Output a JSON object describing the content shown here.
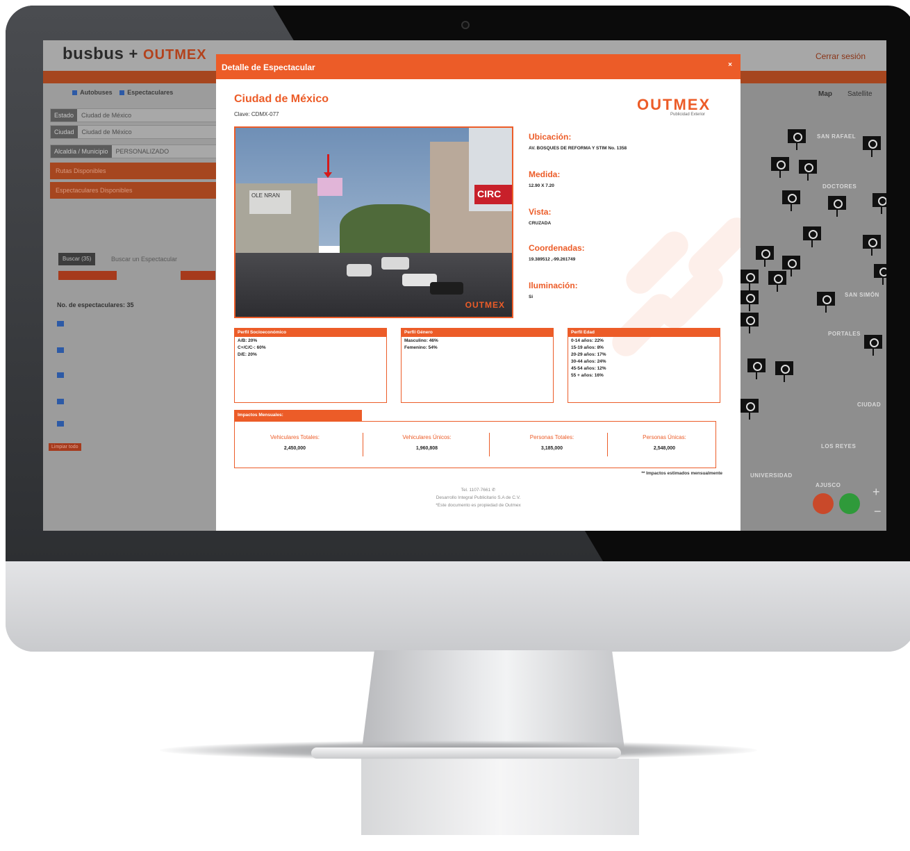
{
  "app": {
    "logo_main": "busbus",
    "logo_plus": "+",
    "logo_partner": "OUTMEX",
    "logout_label": "Cerrar sesión"
  },
  "sidebar": {
    "check_buses": "Autobuses",
    "check_billboards": "Espectaculares",
    "filters": [
      {
        "label": "Estado",
        "value": "Ciudad de México"
      },
      {
        "label": "Ciudad",
        "value": "Ciudad de México"
      },
      {
        "label": "Alcaldía / Municipio",
        "value": "PERSONALIZADO"
      }
    ],
    "sections": [
      "Rutas Disponibles",
      "Espectaculares Disponibles"
    ],
    "search_button": "Buscar (35)",
    "search_placeholder": "Buscar un Espectacular",
    "count_label": "No. de espectaculares: 35",
    "clear_label": "Limpiar todo"
  },
  "map": {
    "tab_map": "Map",
    "tab_satellite": "Satellite",
    "labels": [
      "SAN RAFAEL",
      "DOCTORES",
      "SAN SIMÓN",
      "PORTALES",
      "LOS REYES",
      "AJUSCO",
      "UNIVERSIDAD",
      "CIUDAD"
    ]
  },
  "modal": {
    "title": "Detalle de Espectacular",
    "close": "×",
    "city": "Ciudad de México",
    "clave": "Clave: CDMX-077",
    "brand": "OUTMEX",
    "brand_sub": "Publicidad Exterior",
    "photo_sign": "CIRC",
    "photo_billboard": "OLE NRAN",
    "photo_watermark": "OUTMEX",
    "ubicacion_label": "Ubicación:",
    "ubicacion_value": "AV. BOSQUES DE REFORMA Y STIM No. 1358",
    "medida_label": "Medida:",
    "medida_value": "12.90 X 7.20",
    "vista_label": "Vista:",
    "vista_value": "CRUZADA",
    "coord_label": "Coordenadas:",
    "coord_value": "19.389512 ,-99.261749",
    "ilum_label": "Iluminación:",
    "ilum_value": "Si",
    "perfil_socio": {
      "title": "Perfil Socioeconómico",
      "rows": [
        "A/B: 20%",
        "C+/C/C-: 60%",
        "D/E: 20%"
      ]
    },
    "perfil_genero": {
      "title": "Perfil Género",
      "rows": [
        "Masculino: 46%",
        "Femenino: 54%"
      ]
    },
    "perfil_edad": {
      "title": "Perfil Edad",
      "rows": [
        "0-14 años: 22%",
        "15-19 años: 8%",
        "20-29 años: 17%",
        "30-44 años: 24%",
        "45-54 años: 12%",
        "55 + años: 16%"
      ]
    },
    "impactos_title": "Impactos Mensuales:",
    "impactos": [
      {
        "label": "Vehiculares Totales:",
        "value": "2,450,000"
      },
      {
        "label": "Vehiculares Únicos:",
        "value": "1,960,808"
      },
      {
        "label": "Personas Totales:",
        "value": "3,185,000"
      },
      {
        "label": "Personas Únicas:",
        "value": "2,548,000"
      }
    ],
    "impactos_note": "** Impactos estimados mensualmente",
    "footer_1": "Tel. 1107-7661 ✆",
    "footer_2": "Desarrollo Integral Publicitario S.A de C.V.",
    "footer_3": "*Este documento es propiedad de Outmex"
  },
  "colors": {
    "accent": "#ec5c28",
    "header_dim": "#a6461f"
  }
}
